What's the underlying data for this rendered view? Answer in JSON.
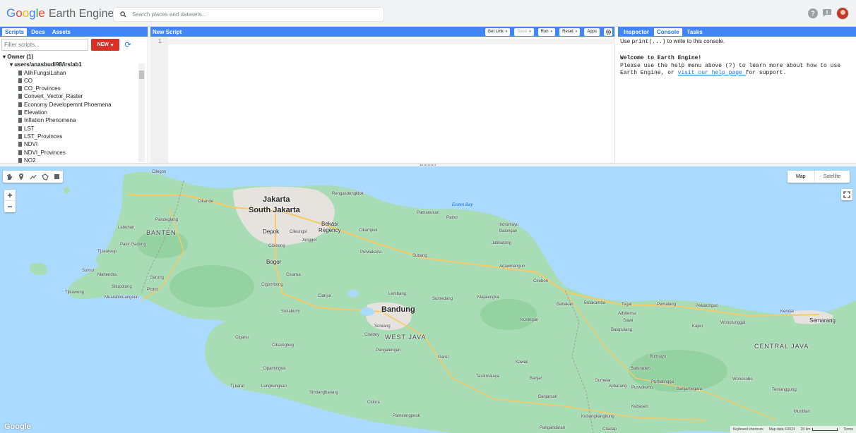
{
  "app": {
    "logo_g": "G",
    "logo_o1": "o",
    "logo_o2": "o",
    "logo_g2": "g",
    "logo_l": "l",
    "logo_e": "e",
    "product": "Earth Engine"
  },
  "search": {
    "placeholder": "Search places and datasets..."
  },
  "header_icons": [
    "help-icon",
    "feedback-icon",
    "avatar"
  ],
  "left_panel": {
    "tabs": [
      {
        "label": "Scripts",
        "active": true
      },
      {
        "label": "Docs",
        "active": false
      },
      {
        "label": "Assets",
        "active": false
      }
    ],
    "filter_placeholder": "Filter scripts...",
    "new_button": "NEW",
    "tree": {
      "owner": "Owner (1)",
      "repo": "users/anasbudi98/irslab1",
      "files": [
        "AlihFungsiLahan",
        "CO",
        "CO_Provinces",
        "Convert_Vector_Raster",
        "Economy Developemnt Phoemena",
        "Elevation",
        "Inflation Phenomena",
        "LST",
        "LST_Provinces",
        "NDVI",
        "NDVI_Provinces",
        "NO2"
      ]
    }
  },
  "editor": {
    "title": "New Script",
    "buttons": {
      "get_link": "Get Link",
      "save": "Save",
      "run": "Run",
      "reset": "Reset",
      "apps": "Apps"
    },
    "line_number": "1"
  },
  "right_panel": {
    "tabs": [
      {
        "label": "Inspector",
        "active": false
      },
      {
        "label": "Console",
        "active": true
      },
      {
        "label": "Tasks",
        "active": false
      }
    ],
    "hint_pre": "Use ",
    "hint_code": "print(...)",
    "hint_post": " to write to this console.",
    "welcome": "Welcome to Earth Engine!",
    "line2": "Please use the help menu above (",
    "line2_icon": "?",
    "line2b": ") to learn more about how to use",
    "line3": "Earth Engine, or ",
    "link": "visit our help page ",
    "line3b": "for support."
  },
  "map": {
    "map_type": {
      "map": "Map",
      "satellite": "Satellite"
    },
    "zoom_in": "+",
    "zoom_out": "−",
    "google_logo": "Google",
    "attribution": {
      "keyboard": "Keyboard shortcuts",
      "data": "Map data ©2024",
      "scale": "20 km",
      "terms": "Terms"
    },
    "colors": {
      "sea": "#aadaff",
      "land": "#a8dcb4",
      "urban": "#e6e3df",
      "highway": "#f8c967",
      "road": "#ffffff",
      "border": "#9e9e9e"
    },
    "labels": {
      "cilegon": "Cilegon",
      "cikande": "Cikande",
      "jakarta": "Jakarta",
      "south_jakarta": "South Jakarta",
      "rengasdengklok": "Rengasdengklok",
      "ersten_bay": "Ersten Bay",
      "pamanukan": "Pamanukan",
      "patrol": "Patrol",
      "indramayu": "Indramayu",
      "balongan": "Balongan",
      "jatibarang": "Jatibarang",
      "pandeglang": "Pandeglang",
      "labuhan": "Labuhan",
      "banten": "BANTEN",
      "depok": "Depok",
      "cileungsi": "Cileungsi",
      "bekasi": "Bekasi",
      "regency": "Regency",
      "cikampek": "Cikampek",
      "jonggol": "Jonggol",
      "cibinong": "Cibinong",
      "pasir_gadung": "Pasir Gadung",
      "tj_teureup": "Tj.teureup",
      "purwakarta": "Purwakarta",
      "subang": "Subang",
      "anjatan": "Arjawinangun",
      "bogor": "Bogor",
      "sumur": "Sumur",
      "mahendra": "Mahendra",
      "garung": "Garung",
      "cisarua": "Cisarua",
      "cigombong": "Cigombong",
      "situpotong": "Situpotong",
      "plotot": "Plotot",
      "tjikawung": "Tjikawung",
      "muarabinuangeun": "Muarabinuangeun",
      "lembang": "Lembang",
      "sumedang": "Sumedang",
      "majalengka": "Majalengka",
      "cirebon": "Cirebon",
      "babakan": "Babakan",
      "bulakamba": "Bulakamba",
      "tegal": "Tegal",
      "pemalang": "Pemalang",
      "pekalongan": "Pekalongan",
      "ciranjur": "Cianjur",
      "sukabumi": "Sukabumi",
      "bandung": "Bandung",
      "kuningan": "Kuningan",
      "adiwerna": "Adiwerna",
      "slawi": "Slawi",
      "kendal": "Kendal",
      "semarang": "Semarang",
      "balapulang": "Balapulang",
      "kajen": "Kajen",
      "wonotunggal": "Wonotunggal",
      "soreang": "Soreang",
      "cidewey": "Ciwidey",
      "west_java": "WEST JAVA",
      "ciganu": "Ciganu",
      "central_java": "CENTRAL JAVA",
      "cibaregbeg": "Cibaregbeg",
      "pangalengan": "Pangalengan",
      "garut": "Garut",
      "bumiayu": "Bumiayu",
      "wonosobo": "Wonosobo",
      "cipamingkis": "Cipamingkis",
      "tasikmalaya": "Tasikmalaya",
      "banjar": "Banjar",
      "gumelar": "Gumelar",
      "ajibarang": "Ajibarang",
      "purwokerto": "Purwokerto",
      "purbalingga": "Purbalingga",
      "banjarnegara": "Banjarnegara",
      "temanggung": "Temanggung",
      "tj_karat": "Tj.karat",
      "lungkungsan": "Lungkungsan",
      "sindangbarang": "Sindangbarang",
      "banjarsari": "Banjarsari",
      "kebasen": "Kebasen",
      "cidora": "Cidora",
      "kubangkangkung": "Kubangkangkung",
      "muntilan": "Muntilan",
      "pamengpeuk": "Pameungpeuk",
      "pangandaran": "Pangandaran",
      "cilacap": "Cilacap",
      "batuaden": "Baturaden",
      "kawali": "Kawali"
    }
  }
}
